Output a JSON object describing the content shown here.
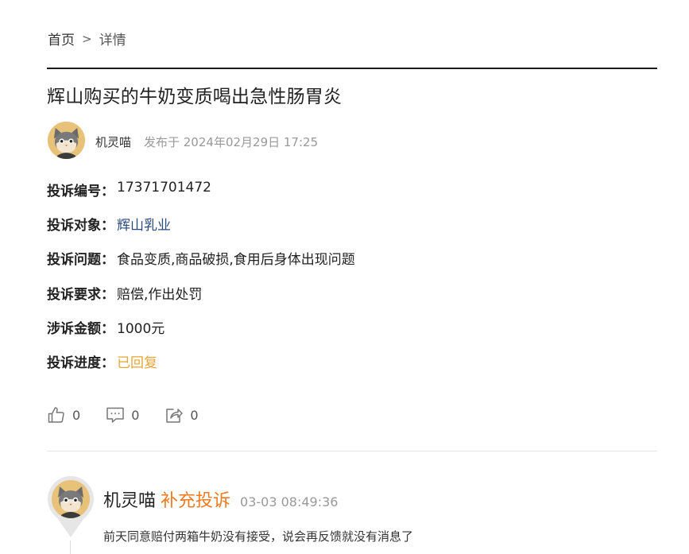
{
  "breadcrumb": {
    "home": "首页",
    "separator": ">",
    "current": "详情"
  },
  "title": "辉山购买的牛奶变质喝出急性肠胃炎",
  "author": {
    "name": "机灵喵",
    "posted_at": "发布于 2024年02月29日 17:25",
    "avatar_icon": "cat-avatar-icon"
  },
  "fields": [
    {
      "label": "投诉编号",
      "value": "17371701472"
    },
    {
      "label": "投诉对象",
      "value": "辉山乳业"
    },
    {
      "label": "投诉问题",
      "value": "食品变质,商品破损,食用后身体出现问题"
    },
    {
      "label": "投诉要求",
      "value": "赔偿,作出处罚"
    },
    {
      "label": "涉诉金额",
      "value": "1000元"
    },
    {
      "label": "投诉进度",
      "value": "已回复"
    }
  ],
  "colon": "：",
  "actions": {
    "likes": "0",
    "comments": "0",
    "shares": "0"
  },
  "reply": {
    "author": "机灵喵",
    "tag": "补充投诉",
    "time": "03-03 08:49:36",
    "text": "前天同意赔付两箱牛奶没有接受，说会再反馈就没有消息了"
  },
  "colors": {
    "link": "#2b4a7e",
    "status": "#e7a534",
    "tag": "#f07a1f",
    "avatar_bg": "#e9c27a"
  }
}
